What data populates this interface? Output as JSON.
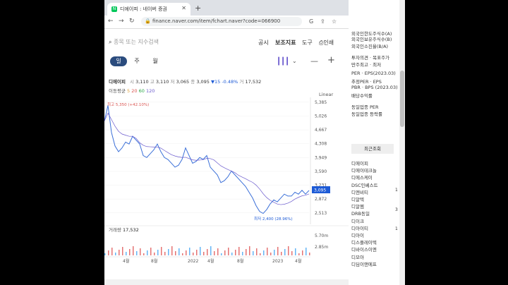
{
  "browser": {
    "tab_title": "디에이피 : 네이버 증권",
    "favicon_letter": "N",
    "url": "finance.naver.com/item/fchart.naver?code=066900"
  },
  "toolbar": {
    "search_placeholder": "종목 또는 지수검색",
    "menu_items": [
      "공시",
      "보조지표",
      "도구",
      "인쇄"
    ]
  },
  "periods": [
    "일",
    "주",
    "월"
  ],
  "quote": {
    "name": "디에이피",
    "open_label": "시",
    "open": "3,110",
    "high_label": "고",
    "high": "3,110",
    "low_label": "저",
    "low": "3,065",
    "close_label": "종",
    "close": "3,095",
    "change": "▼15 -0.48%",
    "volume_label": "거",
    "volume": "17,532"
  },
  "ma": {
    "label": "이동평균",
    "values": [
      "5",
      "20",
      "60",
      "120"
    ],
    "colors": [
      "#e0a13c",
      "#d9534f",
      "#28a745",
      "#6a5acd"
    ]
  },
  "chart_data": {
    "type": "line",
    "scale_label": "Linear",
    "y_ticks": [
      "5,385",
      "5,026",
      "4,667",
      "4,308",
      "3,949",
      "3,590",
      "3,231",
      "2,872",
      "2,513"
    ],
    "x_ticks": [
      "4월",
      "8월",
      "2022",
      "4월",
      "8월",
      "2023",
      "4월"
    ],
    "current_price": "3,095",
    "high_annotation": "최고 5,350 (+42.10%)",
    "low_annotation": "최저 2,400 (28.96%)",
    "volume_label": "거래량",
    "volume_value": "17,532",
    "volume_ticks": [
      "5.70m",
      "2.85m"
    ],
    "ylim": [
      2400,
      5400
    ],
    "price_series": [
      4900,
      5300,
      4600,
      4250,
      4100,
      4200,
      4350,
      4300,
      4500,
      4400,
      4300,
      4000,
      3950,
      4050,
      4150,
      4300,
      4100,
      3950,
      3900,
      3800,
      3700,
      3750,
      3900,
      4200,
      4000,
      3800,
      3850,
      3950,
      3900,
      4000,
      3700,
      3600,
      3500,
      3300,
      3350,
      3450,
      3600,
      3500,
      3400,
      3300,
      3200,
      3050,
      2900,
      2700,
      2550,
      2500,
      2600,
      2750,
      2850,
      2800,
      2900,
      3000,
      2950,
      2950,
      3050,
      3000,
      3100,
      3000,
      3095
    ]
  },
  "sidebar": {
    "items_top": [
      "외국인한도주식수(A)",
      "외국인보유주식수(B)",
      "외국인소진율(B/A)",
      "투자의견 · 목표주가",
      "딴주최고 · 최저",
      "PER · EPS(2023.03)",
      "추정PER · EPS",
      "PBR · BPS (2023.03)",
      "배당수익률",
      "동일업종 PER",
      "동일업종 등락률"
    ],
    "recent_label": "최근조회",
    "items_recent": [
      "디에이피",
      "디에이테크놀",
      "디에스케이",
      "DSC인베스트",
      "디엔비티",
      "디알텍",
      "디알젬",
      "DRB동일",
      "디이크",
      "디아이티",
      "디아이",
      "디스플레이텍",
      "디바이스이엔",
      "디모아",
      "디딤이앤에프"
    ],
    "nums": [
      "1",
      "3",
      "1"
    ]
  }
}
